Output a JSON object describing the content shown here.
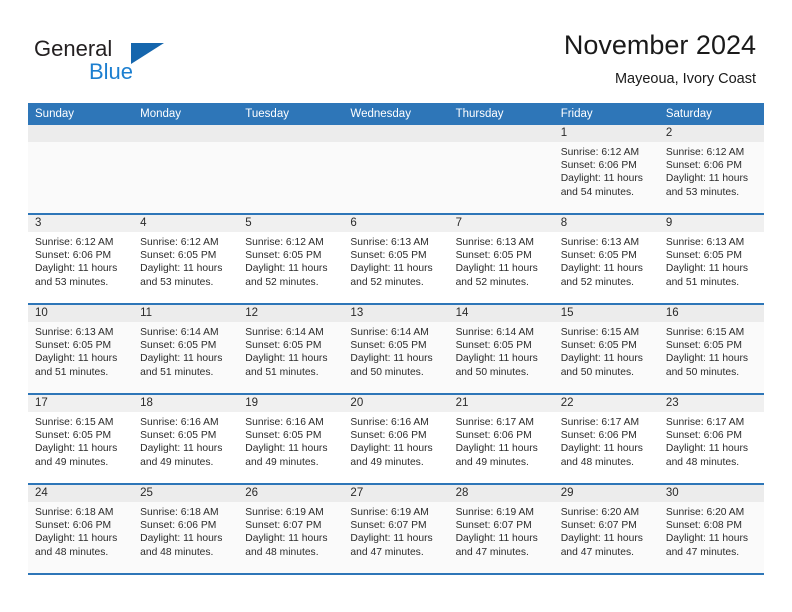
{
  "logo": {
    "word1": "General",
    "word2": "Blue",
    "mark": "triangle-icon",
    "brand_color": "#1566ad"
  },
  "header": {
    "title": "November 2024",
    "subtitle": "Mayeoua, Ivory Coast"
  },
  "theme": {
    "header_blue": "#2e76b8",
    "row_divider": "#2e76b8",
    "daynum_band": "#f0f0f0",
    "shaded_row": "#fafafa"
  },
  "weekday_headers": [
    "Sunday",
    "Monday",
    "Tuesday",
    "Wednesday",
    "Thursday",
    "Friday",
    "Saturday"
  ],
  "labels": {
    "sunrise": "Sunrise:",
    "sunset": "Sunset:",
    "daylight": "Daylight:"
  },
  "weeks": [
    [
      {
        "day": "",
        "l1": "",
        "l2": "",
        "l3": "",
        "l4": ""
      },
      {
        "day": "",
        "l1": "",
        "l2": "",
        "l3": "",
        "l4": ""
      },
      {
        "day": "",
        "l1": "",
        "l2": "",
        "l3": "",
        "l4": ""
      },
      {
        "day": "",
        "l1": "",
        "l2": "",
        "l3": "",
        "l4": ""
      },
      {
        "day": "",
        "l1": "",
        "l2": "",
        "l3": "",
        "l4": ""
      },
      {
        "day": "1",
        "l1": "Sunrise: 6:12 AM",
        "l2": "Sunset: 6:06 PM",
        "l3": "Daylight: 11 hours",
        "l4": "and 54 minutes."
      },
      {
        "day": "2",
        "l1": "Sunrise: 6:12 AM",
        "l2": "Sunset: 6:06 PM",
        "l3": "Daylight: 11 hours",
        "l4": "and 53 minutes."
      }
    ],
    [
      {
        "day": "3",
        "l1": "Sunrise: 6:12 AM",
        "l2": "Sunset: 6:06 PM",
        "l3": "Daylight: 11 hours",
        "l4": "and 53 minutes."
      },
      {
        "day": "4",
        "l1": "Sunrise: 6:12 AM",
        "l2": "Sunset: 6:05 PM",
        "l3": "Daylight: 11 hours",
        "l4": "and 53 minutes."
      },
      {
        "day": "5",
        "l1": "Sunrise: 6:12 AM",
        "l2": "Sunset: 6:05 PM",
        "l3": "Daylight: 11 hours",
        "l4": "and 52 minutes."
      },
      {
        "day": "6",
        "l1": "Sunrise: 6:13 AM",
        "l2": "Sunset: 6:05 PM",
        "l3": "Daylight: 11 hours",
        "l4": "and 52 minutes."
      },
      {
        "day": "7",
        "l1": "Sunrise: 6:13 AM",
        "l2": "Sunset: 6:05 PM",
        "l3": "Daylight: 11 hours",
        "l4": "and 52 minutes."
      },
      {
        "day": "8",
        "l1": "Sunrise: 6:13 AM",
        "l2": "Sunset: 6:05 PM",
        "l3": "Daylight: 11 hours",
        "l4": "and 52 minutes."
      },
      {
        "day": "9",
        "l1": "Sunrise: 6:13 AM",
        "l2": "Sunset: 6:05 PM",
        "l3": "Daylight: 11 hours",
        "l4": "and 51 minutes."
      }
    ],
    [
      {
        "day": "10",
        "l1": "Sunrise: 6:13 AM",
        "l2": "Sunset: 6:05 PM",
        "l3": "Daylight: 11 hours",
        "l4": "and 51 minutes."
      },
      {
        "day": "11",
        "l1": "Sunrise: 6:14 AM",
        "l2": "Sunset: 6:05 PM",
        "l3": "Daylight: 11 hours",
        "l4": "and 51 minutes."
      },
      {
        "day": "12",
        "l1": "Sunrise: 6:14 AM",
        "l2": "Sunset: 6:05 PM",
        "l3": "Daylight: 11 hours",
        "l4": "and 51 minutes."
      },
      {
        "day": "13",
        "l1": "Sunrise: 6:14 AM",
        "l2": "Sunset: 6:05 PM",
        "l3": "Daylight: 11 hours",
        "l4": "and 50 minutes."
      },
      {
        "day": "14",
        "l1": "Sunrise: 6:14 AM",
        "l2": "Sunset: 6:05 PM",
        "l3": "Daylight: 11 hours",
        "l4": "and 50 minutes."
      },
      {
        "day": "15",
        "l1": "Sunrise: 6:15 AM",
        "l2": "Sunset: 6:05 PM",
        "l3": "Daylight: 11 hours",
        "l4": "and 50 minutes."
      },
      {
        "day": "16",
        "l1": "Sunrise: 6:15 AM",
        "l2": "Sunset: 6:05 PM",
        "l3": "Daylight: 11 hours",
        "l4": "and 50 minutes."
      }
    ],
    [
      {
        "day": "17",
        "l1": "Sunrise: 6:15 AM",
        "l2": "Sunset: 6:05 PM",
        "l3": "Daylight: 11 hours",
        "l4": "and 49 minutes."
      },
      {
        "day": "18",
        "l1": "Sunrise: 6:16 AM",
        "l2": "Sunset: 6:05 PM",
        "l3": "Daylight: 11 hours",
        "l4": "and 49 minutes."
      },
      {
        "day": "19",
        "l1": "Sunrise: 6:16 AM",
        "l2": "Sunset: 6:05 PM",
        "l3": "Daylight: 11 hours",
        "l4": "and 49 minutes."
      },
      {
        "day": "20",
        "l1": "Sunrise: 6:16 AM",
        "l2": "Sunset: 6:06 PM",
        "l3": "Daylight: 11 hours",
        "l4": "and 49 minutes."
      },
      {
        "day": "21",
        "l1": "Sunrise: 6:17 AM",
        "l2": "Sunset: 6:06 PM",
        "l3": "Daylight: 11 hours",
        "l4": "and 49 minutes."
      },
      {
        "day": "22",
        "l1": "Sunrise: 6:17 AM",
        "l2": "Sunset: 6:06 PM",
        "l3": "Daylight: 11 hours",
        "l4": "and 48 minutes."
      },
      {
        "day": "23",
        "l1": "Sunrise: 6:17 AM",
        "l2": "Sunset: 6:06 PM",
        "l3": "Daylight: 11 hours",
        "l4": "and 48 minutes."
      }
    ],
    [
      {
        "day": "24",
        "l1": "Sunrise: 6:18 AM",
        "l2": "Sunset: 6:06 PM",
        "l3": "Daylight: 11 hours",
        "l4": "and 48 minutes."
      },
      {
        "day": "25",
        "l1": "Sunrise: 6:18 AM",
        "l2": "Sunset: 6:06 PM",
        "l3": "Daylight: 11 hours",
        "l4": "and 48 minutes."
      },
      {
        "day": "26",
        "l1": "Sunrise: 6:19 AM",
        "l2": "Sunset: 6:07 PM",
        "l3": "Daylight: 11 hours",
        "l4": "and 48 minutes."
      },
      {
        "day": "27",
        "l1": "Sunrise: 6:19 AM",
        "l2": "Sunset: 6:07 PM",
        "l3": "Daylight: 11 hours",
        "l4": "and 47 minutes."
      },
      {
        "day": "28",
        "l1": "Sunrise: 6:19 AM",
        "l2": "Sunset: 6:07 PM",
        "l3": "Daylight: 11 hours",
        "l4": "and 47 minutes."
      },
      {
        "day": "29",
        "l1": "Sunrise: 6:20 AM",
        "l2": "Sunset: 6:07 PM",
        "l3": "Daylight: 11 hours",
        "l4": "and 47 minutes."
      },
      {
        "day": "30",
        "l1": "Sunrise: 6:20 AM",
        "l2": "Sunset: 6:08 PM",
        "l3": "Daylight: 11 hours",
        "l4": "and 47 minutes."
      }
    ]
  ]
}
